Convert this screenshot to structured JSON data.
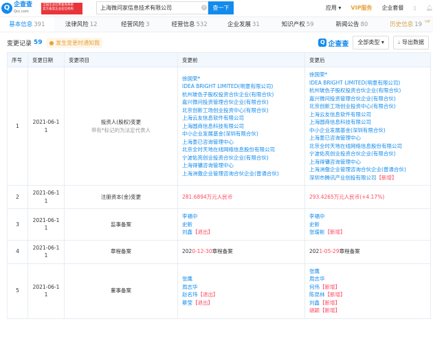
{
  "header": {
    "logo_text": "企查查",
    "logo_domain": "Qcc.com",
    "badge_line1": "全国企业信用查询系统",
    "badge_line2": "官方备案企业征信机构",
    "search_value": "上海微问家信息技术有限公司",
    "search_button": "查一下",
    "nav": [
      "应用 ▾",
      "VIP服务",
      "企业套餐"
    ]
  },
  "tabs": [
    {
      "label": "基本信息",
      "count": "391"
    },
    {
      "label": "法律风险",
      "count": "12"
    },
    {
      "label": "经营风险",
      "count": "3"
    },
    {
      "label": "经营信息",
      "count": "532"
    },
    {
      "label": "企业发展",
      "count": "31"
    },
    {
      "label": "知识产权",
      "count": "59"
    },
    {
      "label": "新闻公告",
      "count": "80"
    },
    {
      "label": "历史信息",
      "count": "19",
      "badge": "VIP"
    }
  ],
  "section": {
    "title": "变更记录",
    "count": "59",
    "notify": "发生变更时通知我",
    "brand": "企查查",
    "filter": "全部类型 ▾",
    "export": "导出数据"
  },
  "columns": [
    "序号",
    "变更日期",
    "变更项目",
    "变更前",
    "变更后"
  ],
  "rows": [
    {
      "no": "1",
      "date": "2021-06-11",
      "item": "投资人(股权)变更",
      "note": "带有*标记的为法定代表人",
      "before": [
        {
          "t": "徐国荣*"
        },
        {
          "t": "IDEA BRIGHT LIMITED(明意有限公司)"
        },
        {
          "t": "杭州玻色子股权投资合伙企业(有限合伙)"
        },
        {
          "t": "嘉兴微问投资管理合伙企业(有限合伙)"
        },
        {
          "t": "北京创新工场创业投资中心(有限合伙)"
        },
        {
          "t": "上海云友信息软件有限公司"
        },
        {
          "t": "上海圆商信息科技有限公司"
        },
        {
          "t": "中小企业发展基金(深圳有限合伙)"
        },
        {
          "t": "上海墨已咨询管理中心"
        },
        {
          "t": "北京全时天地在线网络信息股份有限公司"
        },
        {
          "t": "宁波佑亮创业投资合伙企业(有限合伙)"
        },
        {
          "t": "上海得镛咨询管理中心"
        },
        {
          "t": "上海洲傲企业管理咨询合伙企业(普通合伙)"
        }
      ],
      "after": [
        {
          "t": "徐国荣*"
        },
        {
          "t": "IDEA BRIGHT LIMITED(明意有限公司)"
        },
        {
          "t": "杭州玻色子股权投资合伙企业(有限合伙)"
        },
        {
          "t": "嘉兴微问投资管理合伙企业(有限合伙)"
        },
        {
          "t": "北京创新工场创业投资中心(有限合伙)"
        },
        {
          "t": "上海云友信息软件有限公司"
        },
        {
          "t": "上海圆商信息科技有限公司"
        },
        {
          "t": "中小企业发展基金(深圳有限合伙)"
        },
        {
          "t": "上海墨已咨询管理中心"
        },
        {
          "t": "北京全时天地在线网络信息股份有限公司"
        },
        {
          "t": "宁波佑亮创业投资合伙企业(有限合伙)"
        },
        {
          "t": "上海得镛咨询管理中心"
        },
        {
          "t": "上海洲傲企业管理咨询合伙企业(普通合伙)"
        },
        {
          "t": "深圳市腾讯产业创投有限公司",
          "tag": "【新增】"
        }
      ]
    },
    {
      "no": "2",
      "date": "2021-06-11",
      "item": "注册资本(金)变更",
      "before_text": [
        "",
        "281.6894万元人民币",
        ""
      ],
      "after_text": [
        "",
        "293.4265万元人民币(+4.17%)",
        ""
      ]
    },
    {
      "no": "3",
      "date": "2021-06-11",
      "item": "监事备案",
      "before": [
        {
          "t": "李福中"
        },
        {
          "t": "史新"
        },
        {
          "t": "刘鑫",
          "tag": "【退出】"
        }
      ],
      "after": [
        {
          "t": "李福中"
        },
        {
          "t": "史新"
        },
        {
          "t": "张瑷彬",
          "tag": "【新增】"
        }
      ]
    },
    {
      "no": "4",
      "date": "2021-06-11",
      "item": "章程备案",
      "before_text": [
        "202",
        "0-12-30",
        "章程备案"
      ],
      "after_text": [
        "202",
        "1-05-29",
        "章程备案"
      ]
    },
    {
      "no": "5",
      "date": "2021-06-11",
      "item": "董事备案",
      "before": [
        {
          "t": "张鹰"
        },
        {
          "t": "周志华"
        },
        {
          "t": "赵名玮",
          "tag": "【退出】"
        },
        {
          "t": "蔡莹",
          "tag": "【退出】"
        }
      ],
      "after": [
        {
          "t": "张鹰"
        },
        {
          "t": "周志华"
        },
        {
          "t": "何伟",
          "tag": "【新增】"
        },
        {
          "t": "陈昆林",
          "tag": "【新增】"
        },
        {
          "t": "刘鑫",
          "tag": "【新增】"
        },
        {
          "t": "胡颖",
          "tag": "【新增】",
          "red": true
        }
      ]
    }
  ],
  "colors": {
    "accent": "#128bed",
    "red": "#fd485e",
    "vip": "#d6a24a"
  }
}
